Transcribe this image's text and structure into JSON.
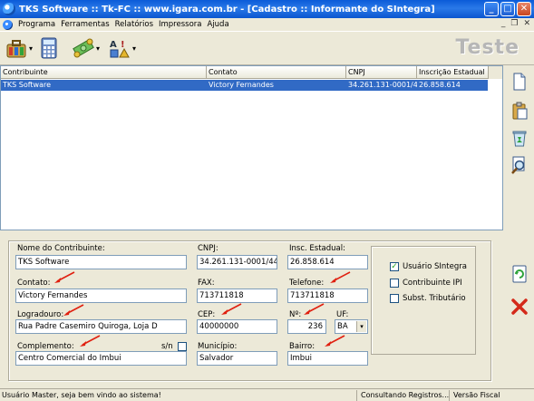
{
  "window": {
    "title": "TKS Software  ::  Tk-FC  ::  www.igara.com.br - [Cadastro :: Informante do SIntegra]",
    "minimize": "_",
    "maximize": "□",
    "close": "✕"
  },
  "menu": {
    "items": [
      "Programa",
      "Ferramentas",
      "Relatórios",
      "Impressora",
      "Ajuda"
    ],
    "mdi_minimize": "_",
    "mdi_restore": "❐",
    "mdi_close": "✕"
  },
  "toolbar": {
    "brand": "Teste",
    "dropdown_arrow": "▾"
  },
  "list": {
    "columns": [
      "Contribuinte",
      "Contato",
      "CNPJ",
      "Inscrição Estadual"
    ],
    "rows": [
      [
        "TKS Software",
        "Victory Fernandes",
        "34.261.131-0001/44",
        "26.858.614"
      ]
    ]
  },
  "form": {
    "nome_label": "Nome do Contribuinte:",
    "nome_value": "TKS Software",
    "cnpj_label": "CNPJ:",
    "cnpj_value": "34.261.131-0001/44",
    "insc_label": "Insc. Estadual:",
    "insc_value": "26.858.614",
    "contato_label": "Contato:",
    "contato_value": "Victory Fernandes",
    "fax_label": "FAX:",
    "fax_value": "713711818",
    "telefone_label": "Telefone:",
    "telefone_value": "713711818",
    "logradouro_label": "Logradouro:",
    "logradouro_value": "Rua Padre Casemiro Quiroga, Loja D",
    "cep_label": "CEP:",
    "cep_value": "40000000",
    "numero_label": "Nº:",
    "numero_value": "236",
    "uf_label": "UF:",
    "uf_value": "BA",
    "complemento_label": "Complemento:",
    "complemento_value": "Centro Comercial do Imbui",
    "sn_label": "s/n",
    "municipio_label": "Município:",
    "municipio_value": "Salvador",
    "bairro_label": "Bairro:",
    "bairro_value": "Imbui",
    "usuario_sintegra_label": "Usuário SIntegra",
    "usuario_sintegra_check": "✓",
    "contribuinte_ipi_label": "Contribuinte IPI",
    "subst_tributario_label": "Subst. Tributário"
  },
  "status": {
    "message": "Usuário Master, seja bem vindo ao sistema!",
    "activity": "Consultando Registros...",
    "version": "Versão Fiscal"
  }
}
